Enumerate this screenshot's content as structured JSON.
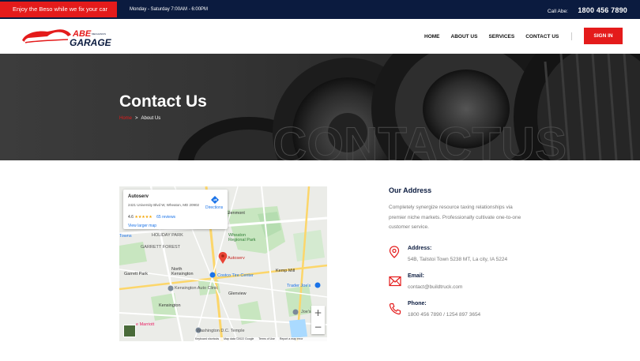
{
  "topbar": {
    "promo": "Enjoy the Beso while we fix your car",
    "hours": "Monday - Saturday 7:00AM - 6:00PM",
    "call_label": "Call Abe:",
    "phone": "1800 456 7890"
  },
  "brand": {
    "logo_top": "ABE",
    "logo_bottom": "GARAGE",
    "logo_small": "MECHANICS"
  },
  "nav": {
    "items": [
      "HOME",
      "ABOUT US",
      "SERVICES",
      "CONTACT US"
    ],
    "signin": "SIGN IN"
  },
  "hero": {
    "title": "Contact Us",
    "crumb_home": "Home",
    "crumb_sep": ">",
    "crumb_current": "About Us",
    "watermark": "CONTACTUS"
  },
  "map": {
    "place_name": "Autoserv",
    "place_address": "2421 University Blvd W, Wheaton, MD 20902",
    "rating": "4.6",
    "stars": "★★★★★",
    "reviews": "65 reviews",
    "larger_map": "View larger map",
    "directions": "Directions",
    "zoom_in": "+",
    "zoom_out": "−",
    "footer": [
      "Keyboard shortcuts",
      "Map data ©2022 Google",
      "Terms of Use",
      "Report a map error"
    ],
    "labels": {
      "glenmont": "Glenmont",
      "wheaton_park": "Wheaton Regional Park",
      "holiday_park": "HOLIDAY PARK",
      "garrett_forest": "GARRETT FOREST",
      "towns": "Towns",
      "autoserv_pin": "Autoserv",
      "north_kensington": "North Kensington",
      "garrett_park": "Garrett Park",
      "kemp_mill": "Kemp Mill",
      "costco": "Costco Tire Center",
      "trader_joes": "Trader Joe's",
      "kensington_clinic": "Kensington Auto Clinic",
      "glenview": "Glenview",
      "kensington": "Kensington",
      "marriott": "e Marriott",
      "washington_temple": "Washington D.C. Temple",
      "joes": "Joe's"
    }
  },
  "contact": {
    "heading": "Our Address",
    "description": "Completely synergize resource taxing relationships via premier niche markets. Professionally cultivate one-to-one customer service.",
    "address_label": "Address:",
    "address_value": "54B, Tailstoi Town 5238 MT, La city, IA 5224",
    "email_label": "Email:",
    "email_value": "contact@buildtruck.com",
    "phone_label": "Phone:",
    "phone_value": "1800 456 7890 / 1254 897 3654"
  },
  "colors": {
    "accent": "#e41b1b",
    "navy": "#0b1b3f"
  }
}
